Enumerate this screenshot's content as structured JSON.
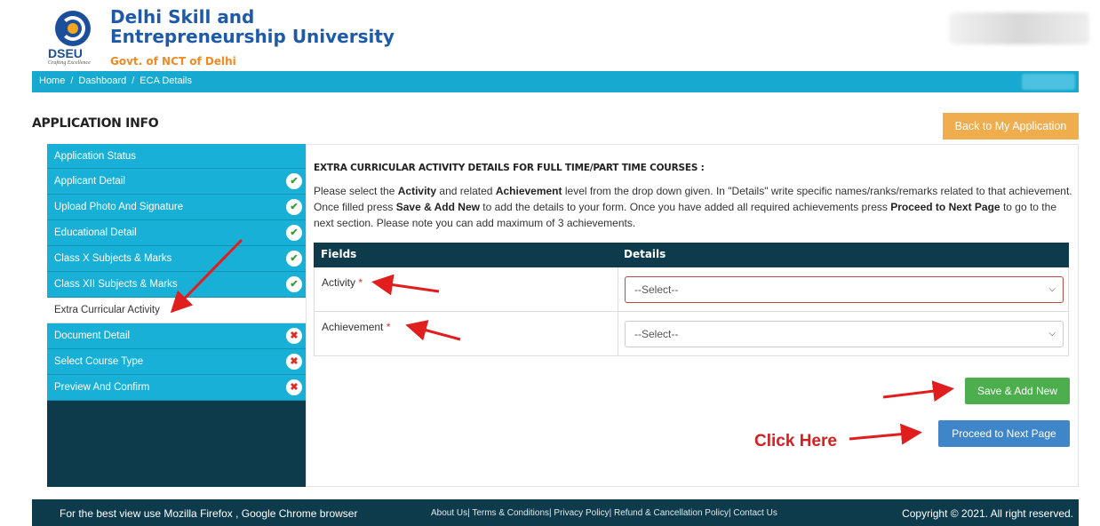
{
  "brand": {
    "logo_text": "DSEU",
    "logo_tagline": "Crafting Excellence",
    "name_line1": "Delhi Skill and",
    "name_line2": "Entrepreneurship University",
    "subtitle": "Govt. of NCT of Delhi"
  },
  "breadcrumb": [
    "Home",
    "Dashboard",
    "ECA Details"
  ],
  "page_title": "APPLICATION INFO",
  "back_button": "Back to My Application",
  "sidebar": {
    "items": [
      {
        "label": "Application Status",
        "status": "none"
      },
      {
        "label": "Applicant Detail",
        "status": "complete"
      },
      {
        "label": "Upload Photo And Signature",
        "status": "complete"
      },
      {
        "label": "Educational Detail",
        "status": "complete"
      },
      {
        "label": "Class X Subjects & Marks",
        "status": "complete"
      },
      {
        "label": "Class XII Subjects & Marks",
        "status": "complete"
      },
      {
        "label": "Extra Curricular Activity",
        "status": "active"
      },
      {
        "label": "Document Detail",
        "status": "incomplete"
      },
      {
        "label": "Select Course Type",
        "status": "incomplete"
      },
      {
        "label": "Preview And Confirm",
        "status": "incomplete"
      }
    ]
  },
  "main": {
    "section_title": "EXTRA CURRICULAR ACTIVITY DETAILS FOR FULL TIME/PART TIME COURSES :",
    "instructions": {
      "p1": "Please select the ",
      "b1": "Activity",
      "p2": " and related ",
      "b2": "Achievement",
      "p3": " level from the drop down given. In \"Details\" write specific names/ranks/remarks related to that achievement. Once filled press ",
      "b3": "Save & Add New",
      "p4": " to add the details to your form. Once you have added all required achievements press ",
      "b4": "Proceed to Next Page",
      "p5": " to go to the next section. Please note you can add maximum of 3 achievements."
    },
    "table": {
      "headers": [
        "Fields",
        "Details"
      ],
      "rows": [
        {
          "label": "Activity",
          "required": "*",
          "select_value": "--Select--"
        },
        {
          "label": "Achievement",
          "required": "*",
          "select_value": "--Select--"
        }
      ]
    },
    "save_button": "Save & Add New",
    "next_button": "Proceed to Next Page",
    "annotation": "Click Here"
  },
  "footer": {
    "left": "For the best view use Mozilla Firefox , Google Chrome browser",
    "links": "About Us| Terms & Conditions| Privacy Policy| Refund & Cancellation Policy| Contact Us",
    "right": "Copyright © 2021. All right reserved."
  },
  "colors": {
    "accent": "#17a9cf",
    "dark": "#0d3b4c",
    "orange": "#f0ad4e",
    "green": "#4cae4c",
    "blue": "#3f86c8",
    "annotation_red": "#e01e1e"
  },
  "icons": {
    "complete": "check-circle-icon",
    "incomplete": "x-circle-icon",
    "select": "chevron-down-icon"
  }
}
